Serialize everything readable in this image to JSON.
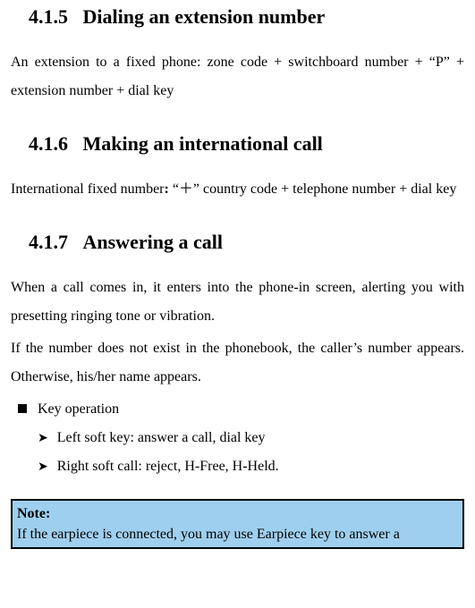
{
  "sections": {
    "s1": {
      "number": "4.1.5",
      "title": "Dialing an extension number",
      "body": "An extension to a fixed phone: zone code + switchboard number + “P” + extension number + dial key"
    },
    "s2": {
      "number": "4.1.6",
      "title": "Making an international call",
      "body_prefix": "International fixed number",
      "body_colon": ":",
      "body_suffix": " “＋” country code + telephone number + dial key"
    },
    "s3": {
      "number": "4.1.7",
      "title": "Answering a call",
      "p1": "When a call comes in, it enters into the phone-in screen, alerting you with presetting ringing tone or vibration.",
      "p2": "If the number does not exist in the phonebook, the caller’s number appears. Otherwise, his/her name appears.",
      "bullet1": "Key operation",
      "sub1": "Left soft key: answer a call, dial key",
      "sub2": "Right soft call: reject, H-Free, H-Held."
    },
    "note": {
      "label": "Note:",
      "body": "If the earpiece is connected, you may use Earpiece key to answer a"
    }
  }
}
